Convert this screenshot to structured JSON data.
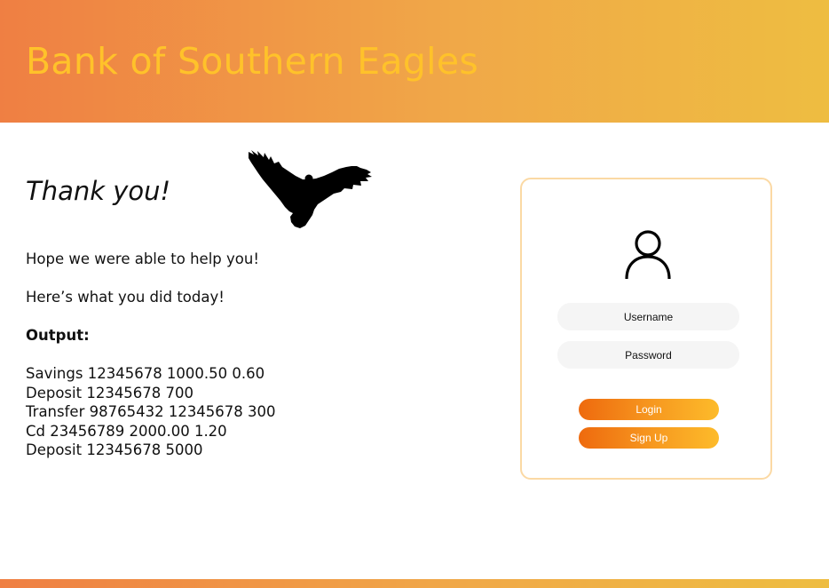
{
  "header": {
    "title": "Bank of Southern Eagles",
    "gradient_colors": [
      "#ef7f43",
      "#f0a848",
      "#eebd41"
    ],
    "title_color": "#ffc22a"
  },
  "main": {
    "heading": "Thank you!",
    "eagle_icon": "eagle-silhouette-icon",
    "message": "Hope we were able to help you!",
    "summary_intro": "Here’s what you did today!",
    "output_label": "Output:",
    "output_lines": [
      "Savings 12345678 1000.50 0.60",
      "Deposit 12345678 700",
      "Transfer 98765432 12345678 300",
      "Cd 23456789 2000.00 1.20",
      "Deposit 12345678 5000"
    ]
  },
  "login": {
    "user_icon": "user-icon",
    "username_placeholder": "Username",
    "password_placeholder": "Password",
    "login_label": "Login",
    "signup_label": "Sign Up",
    "border_color": "#fbd9a4",
    "button_gradient": [
      "#ee6a0e",
      "#fdbb2a"
    ]
  }
}
